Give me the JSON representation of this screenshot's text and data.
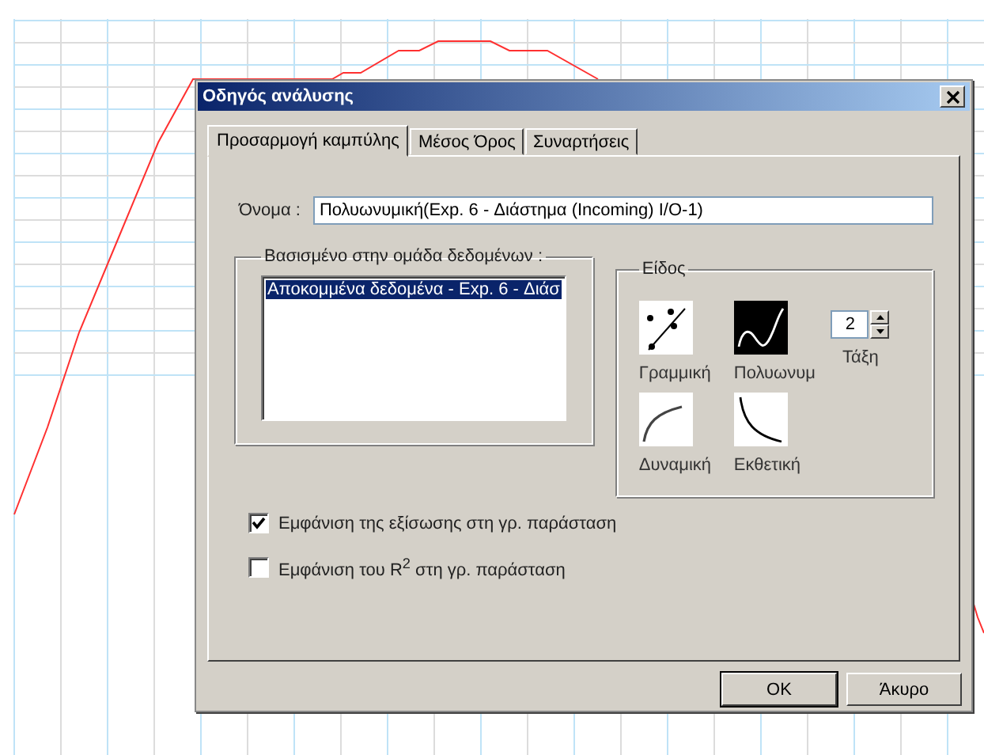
{
  "window": {
    "title": "Οδηγός ανάλυσης"
  },
  "tabs": [
    {
      "label": "Προσαρμογή καμπύλης",
      "selected": true
    },
    {
      "label": "Μέσος Όρος",
      "selected": false
    },
    {
      "label": "Συναρτήσεις",
      "selected": false
    }
  ],
  "name_field": {
    "label": "Όνομα :",
    "value": "Πολυωνυμική(Exp. 6 - Διάστημα (Incoming) I/O-1)"
  },
  "dataset_group": {
    "title": "Βασισμένο στην ομάδα δεδομένων :",
    "items": [
      {
        "label": "Αποκομμένα δεδομένα - Exp. 6 - Διάσ",
        "selected": true
      }
    ]
  },
  "type_group": {
    "title": "Είδος",
    "fits": [
      {
        "kind": "linear",
        "label": "Γραμμική",
        "selected": false
      },
      {
        "kind": "polynomial",
        "label": "Πολυωνυμ",
        "selected": true
      },
      {
        "kind": "power",
        "label": "Δυναμική",
        "selected": false
      },
      {
        "kind": "exponential",
        "label": "Εκθετική",
        "selected": false
      }
    ],
    "order": {
      "label": "Τάξη",
      "value": "2"
    }
  },
  "options": [
    {
      "label": "Εμφάνιση της εξίσωσης στη γρ. παράσταση",
      "checked": true
    },
    {
      "label": "Εμφάνιση του R$^{2}$ στη γρ. παράσταση",
      "checked": false
    }
  ],
  "buttons": [
    "OK",
    "Άκυρο"
  ]
}
